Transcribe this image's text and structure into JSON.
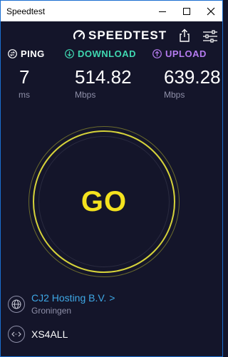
{
  "window": {
    "title": "Speedtest"
  },
  "header": {
    "logo_text": "SPEEDTEST",
    "share_icon": "share-icon",
    "settings_icon": "settings-sliders-icon"
  },
  "metrics": {
    "ping": {
      "label": "PING",
      "value": "7",
      "unit": "ms",
      "color": "#ffffff",
      "icon": "ping-icon"
    },
    "download": {
      "label": "DOWNLOAD",
      "value": "514.82",
      "unit": "Mbps",
      "color": "#3fd7b0",
      "icon": "download-arrow-icon"
    },
    "upload": {
      "label": "UPLOAD",
      "value": "639.28",
      "unit": "Mbps",
      "color": "#b57bf0",
      "icon": "upload-arrow-icon"
    }
  },
  "go_button": {
    "label": "GO",
    "color": "#f4e21e"
  },
  "server": {
    "host": "CJ2 Hosting B.V. >",
    "location": "Groningen",
    "icon": "globe-icon"
  },
  "isp": {
    "name": "XS4ALL",
    "icon": "connection-icon"
  },
  "colors": {
    "background": "#14152a",
    "accent_link": "#3ea8e6",
    "muted": "#8e8fa8"
  }
}
